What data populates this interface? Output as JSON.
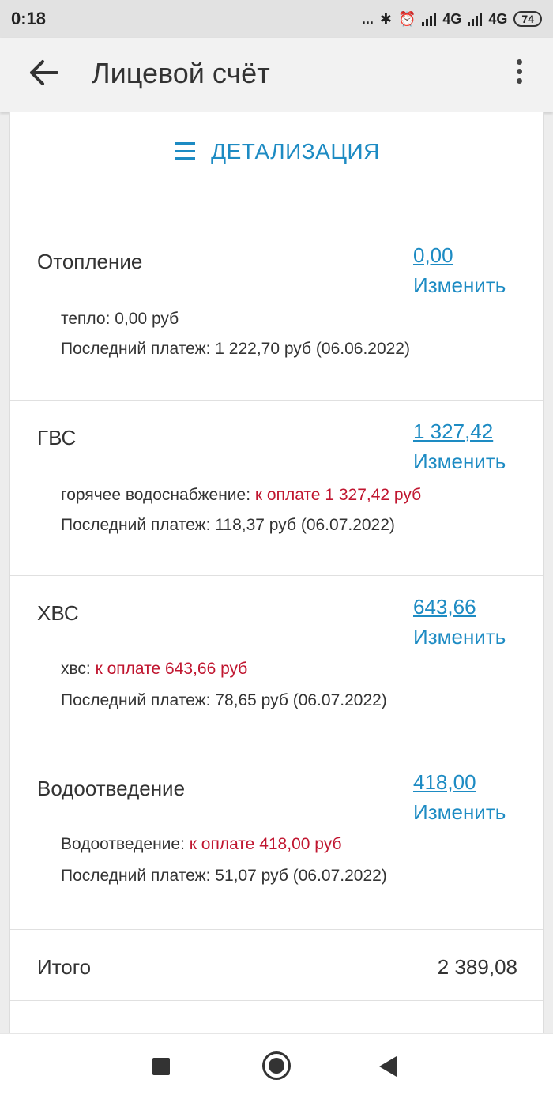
{
  "status_bar": {
    "time": "0:18",
    "dots": "...",
    "net1": "4G",
    "net2": "4G",
    "battery": "74"
  },
  "app_bar": {
    "title": "Лицевой счёт",
    "icons": {
      "back": "arrow-left-icon",
      "menu": "more-vert-icon"
    }
  },
  "detail": {
    "label": "ДЕТАЛИЗАЦИЯ",
    "icon": "menu-icon"
  },
  "colors": {
    "accent": "#1d8bc3",
    "due": "#c0152f"
  },
  "services": [
    {
      "name": "Отопление",
      "amount": "0,00",
      "change": "Изменить",
      "line1": {
        "label": "тепло:",
        "text": " 0,00 руб",
        "due_prefix": "",
        "due_amount": ""
      },
      "last_payment": "Последний платеж: 1 222,70 руб (06.06.2022)"
    },
    {
      "name": "ГВС",
      "amount": "1 327,42",
      "change": "Изменить",
      "line1": {
        "label": "горячее водоснабжение:",
        "text": "",
        "due_prefix": " к оплате",
        "due_amount": "  1 327,42 руб"
      },
      "last_payment": "Последний платеж: 118,37 руб (06.07.2022)"
    },
    {
      "name": "ХВС",
      "amount": "643,66",
      "change": "Изменить",
      "line1": {
        "label": "хвс:",
        "text": "",
        "due_prefix": " к оплате",
        "due_amount": "  643,66 руб"
      },
      "last_payment": "Последний платеж: 78,65 руб (06.07.2022)"
    },
    {
      "name": "Водоотведение",
      "amount": "418,00",
      "change": "Изменить",
      "line1": {
        "label": "Водоотведение:",
        "text": "",
        "due_prefix": " к оплате",
        "due_amount": "  418,00 руб"
      },
      "last_payment": "Последний платеж: 51,07 руб (06.07.2022)"
    }
  ],
  "total": {
    "label": "Итого",
    "value": "2 389,08"
  }
}
